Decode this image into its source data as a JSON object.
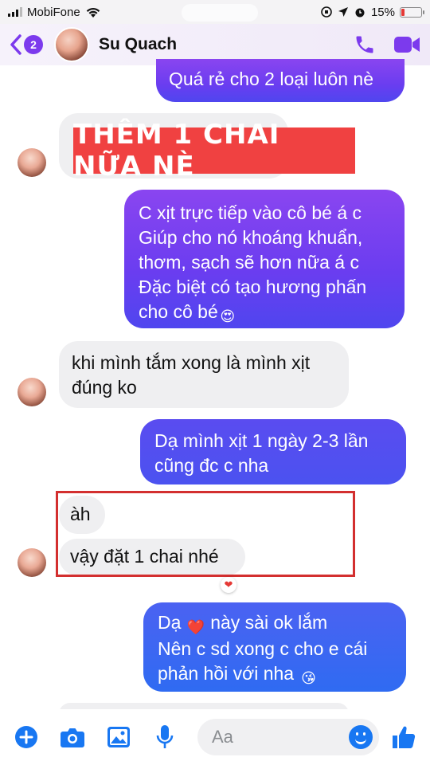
{
  "status_bar": {
    "carrier": "MobiFone",
    "battery": "15%"
  },
  "header": {
    "back_count": "2",
    "contact_name": "Su Quach"
  },
  "overlay": {
    "banner_text": "THÊM 1 CHAI NỮA NÈ"
  },
  "messages": [
    {
      "side": "out",
      "lines": [
        "Quá rẻ cho 2 loại luôn nè"
      ]
    },
    {
      "side": "in",
      "lines": [
        ""
      ]
    },
    {
      "side": "out",
      "lines": [
        "C xịt trực tiếp vào cô bé á c",
        "Giúp cho nó khoáng khuẩn,",
        "thơm, sạch sẽ hơn nữa á c",
        "Đặc biệt có tạo hương phấn",
        "cho cô bé"
      ],
      "emoji": "😍"
    },
    {
      "side": "in",
      "lines": [
        "khi mình tắm xong là mình xịt",
        "đúng ko"
      ]
    },
    {
      "side": "out",
      "lines": [
        "Dạ mình xịt 1 ngày 2-3 lần",
        "cũng đc c nha"
      ]
    },
    {
      "side": "in",
      "lines": [
        "àh"
      ]
    },
    {
      "side": "in",
      "lines": [
        "vậy đặt 1 chai nhé"
      ]
    },
    {
      "side": "out",
      "lines": [
        "Dạ",
        "này sài ok lắm",
        "Nên c sd xong c cho e cái",
        "phản hồi với nha"
      ],
      "emoji_heart": "❤️",
      "emoji_kiss": "😘"
    }
  ],
  "reaction": "❤",
  "composer": {
    "placeholder": "Aa"
  },
  "icons": [
    "plus-circle-icon",
    "camera-icon",
    "image-icon",
    "microphone-icon",
    "emoji-icon",
    "thumbs-up-icon",
    "phone-icon",
    "video-icon"
  ],
  "colors": {
    "accent": "#7c3aed",
    "outgoing_bubble": "#6a3df0",
    "incoming_bubble": "#efeff1",
    "banner": "#f04141",
    "highlight_border": "#d32f2f",
    "toolbar_icons": "#1877f2"
  }
}
